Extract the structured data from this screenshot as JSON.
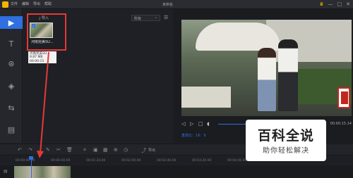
{
  "titlebar": {
    "menu": [
      "文件",
      "编辑",
      "导出",
      "帮助"
    ],
    "title": "未命名",
    "crown_icon": "crown-icon",
    "minimize": "—",
    "maximize": "□",
    "close": "✕"
  },
  "sidebar": {
    "items": [
      {
        "icon": "media-icon",
        "glyph": "▶"
      },
      {
        "icon": "text-icon",
        "glyph": "T"
      },
      {
        "icon": "filter-icon",
        "glyph": "⊛"
      },
      {
        "icon": "overlay-icon",
        "glyph": "◈"
      },
      {
        "icon": "transition-icon",
        "glyph": "⇆"
      },
      {
        "icon": "element-icon",
        "glyph": "▤"
      }
    ]
  },
  "media": {
    "import_label": "导入",
    "filter_value": "所有",
    "clip_name": "河南完美SU...",
    "tooltip": {
      "line1": "河南完美SU...",
      "line2": "9.87 MB",
      "line3": "00:00:15"
    }
  },
  "preview": {
    "ratio_label": "宽高比：",
    "ratio_value": "16：9",
    "time_right": "00:00:15.14"
  },
  "edittools": {
    "export_label": "导出"
  },
  "timeline": {
    "ticks": [
      "00:00:00.00",
      "00:00:40.00",
      "00:01:20.00",
      "00:02:00.00",
      "00:02:40.00",
      "00:03:20.00",
      "00:04:00.00",
      "00:04:40.00",
      "00:05:20.00"
    ]
  },
  "watermark": {
    "main": "百科全说",
    "sub": "助你轻松解决"
  },
  "colors": {
    "accent": "#2f6fe0",
    "highlight": "#e53935",
    "brand": "#f5b400"
  }
}
